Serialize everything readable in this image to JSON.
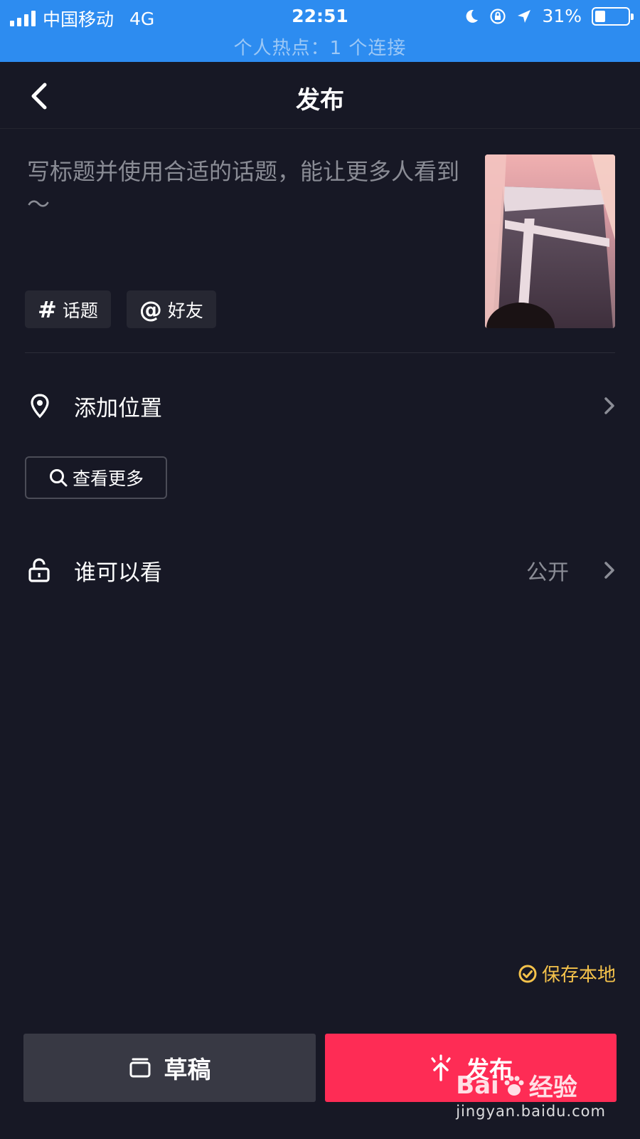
{
  "status_bar": {
    "carrier": "中国移动",
    "network": "4G",
    "time": "22:51",
    "battery": "31%",
    "battery_level": 0.31,
    "hotspot": "个人热点：1 个连接",
    "icons": [
      "signal-icon",
      "moon-icon",
      "rotation-lock-icon",
      "location-arrow-icon",
      "battery-icon"
    ]
  },
  "nav": {
    "title": "发布",
    "back_icon": "chevron-left-icon"
  },
  "caption": {
    "placeholder": "写标题并使用合适的话题，能让更多人看到～"
  },
  "chips": [
    {
      "symbol": "#",
      "label": "话题"
    },
    {
      "symbol": "@",
      "label": "好友"
    }
  ],
  "location": {
    "label": "添加位置",
    "see_more": "查看更多"
  },
  "visibility": {
    "label": "谁可以看",
    "value": "公开"
  },
  "save_local": "保存本地",
  "buttons": {
    "draft": "草稿",
    "publish": "发布"
  },
  "watermark": {
    "brand": "Bai",
    "brand_suffix": "经验",
    "url": "jingyan.baidu.com"
  },
  "colors": {
    "status_bar": "#2d8cf0",
    "background": "#171825",
    "publish": "#fe2c55",
    "save_local": "#f4c24b"
  }
}
